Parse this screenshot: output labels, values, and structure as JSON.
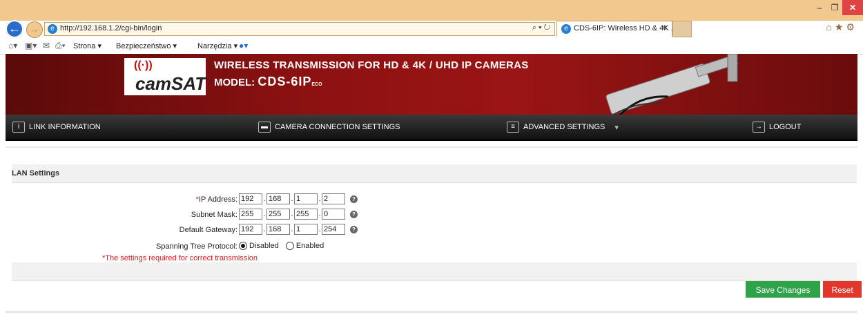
{
  "browser": {
    "url": "http://192.168.1.2/cgi-bin/login",
    "tab_title": "CDS-6IP: Wireless HD & 4K ...",
    "menu": {
      "page": "Strona",
      "security": "Bezpieczeństwo",
      "tools": "Narzędzia"
    }
  },
  "banner": {
    "logo": "camSAT",
    "title": "WIRELESS TRANSMISSION FOR HD & 4K / UHD IP CAMERAS",
    "model_label": "MODEL:",
    "model_name": "CDS-6IP",
    "model_suffix": "ECO"
  },
  "nav": {
    "link_info": "LINK INFORMATION",
    "camera_settings": "CAMERA CONNECTION SETTINGS",
    "advanced": "ADVANCED SETTINGS",
    "logout": "LOGOUT"
  },
  "section": {
    "title": "LAN Settings"
  },
  "form": {
    "ip_label": "IP Address:",
    "ip_required_mark": "*",
    "ip": [
      "192",
      "168",
      "1",
      "2"
    ],
    "mask_label": "Subnet Mask:",
    "mask": [
      "255",
      "255",
      "255",
      "0"
    ],
    "gateway_label": "Default Gateway:",
    "gateway": [
      "192",
      "168",
      "1",
      "254"
    ],
    "stp_label": "Spanning Tree Protocol:",
    "stp_disabled": "Disabled",
    "stp_enabled": "Enabled",
    "stp_selected": "Disabled",
    "required_note": "*The settings required for correct transmission"
  },
  "buttons": {
    "save": "Save Changes",
    "reset": "Reset"
  },
  "colors": {
    "save": "#2fa34a",
    "reset": "#e0382e",
    "banner": "#8c1111",
    "required": "#d61c1c"
  }
}
